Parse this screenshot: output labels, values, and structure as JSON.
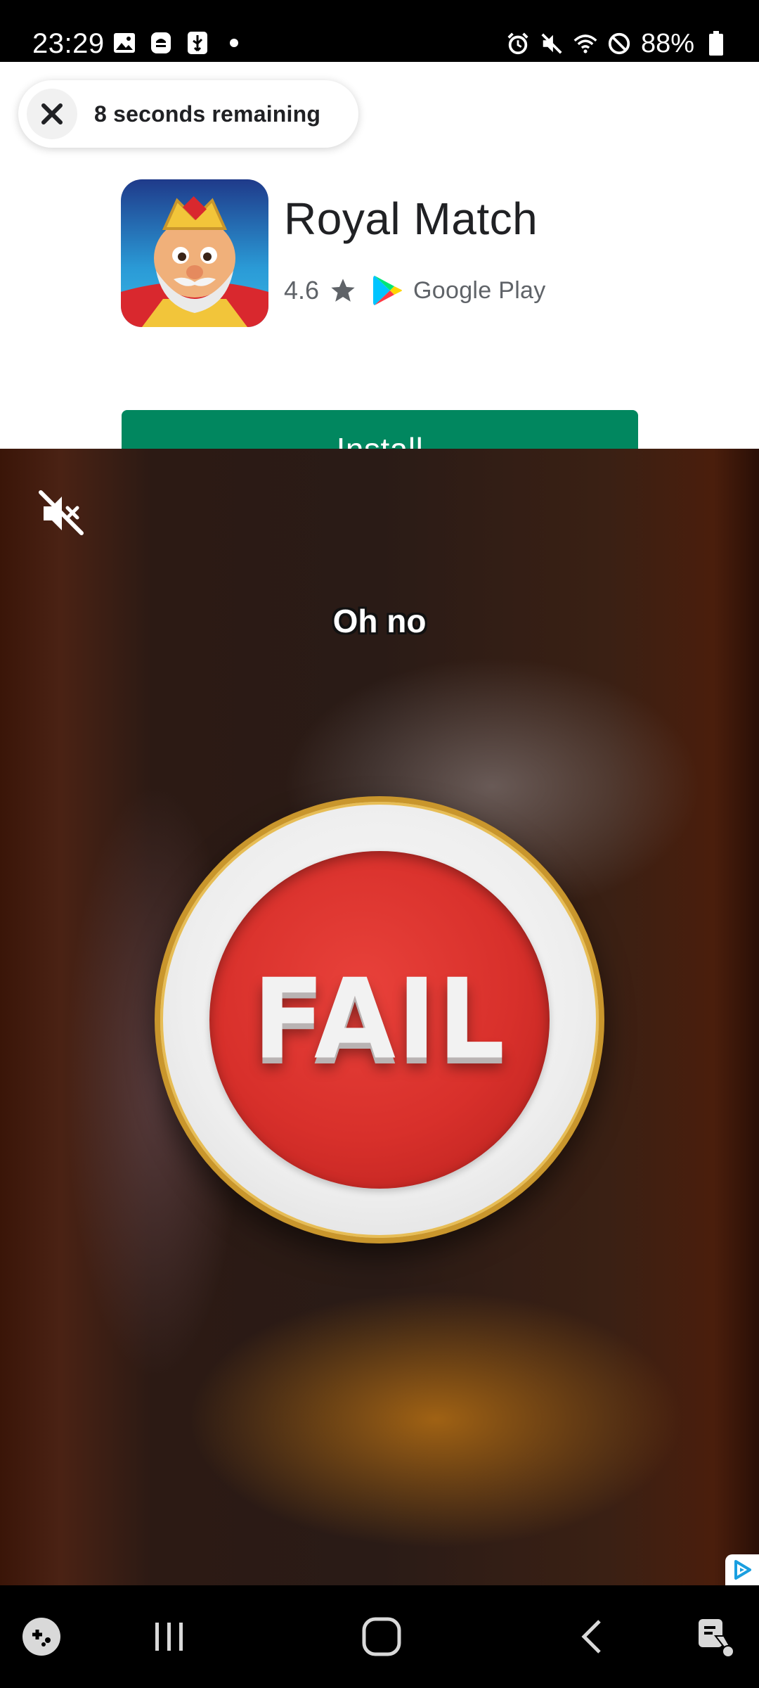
{
  "status_bar": {
    "time": "23:29",
    "battery_percent": "88%",
    "left_icons": [
      "gallery-icon",
      "vpn-icon",
      "usb-debug-icon",
      "dot-icon"
    ],
    "right_icons": [
      "alarm-icon",
      "mute-icon",
      "wifi-icon",
      "dnd-icon",
      "battery-icon"
    ]
  },
  "ad": {
    "timer_text": "8 seconds remaining",
    "app_name": "Royal Match",
    "rating": "4.6",
    "store_label": "Google Play",
    "install_label": "Install",
    "colors": {
      "install": "#01875f"
    }
  },
  "video": {
    "caption": "Oh no",
    "badge_text": "FAIL"
  },
  "nav_bar": {
    "items": [
      "game-launcher-icon",
      "recents-icon",
      "home-icon",
      "back-icon",
      "assistant-icon"
    ]
  }
}
